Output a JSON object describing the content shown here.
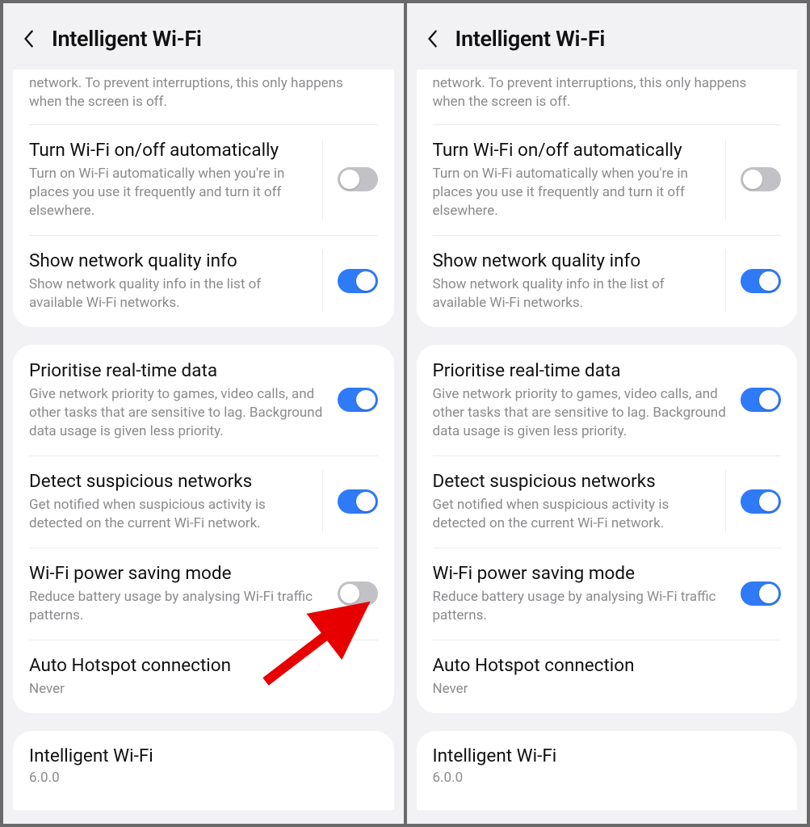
{
  "screens": [
    {
      "id": "left",
      "header": {
        "title": "Intelligent Wi‑Fi"
      },
      "top_cut_text": "network. To prevent interruptions, this only happens when the screen is off.",
      "group1": [
        {
          "key": "auto_wifi",
          "title": "Turn Wi‑Fi on/off automatically",
          "sub": "Turn on Wi‑Fi automatically when you're in places you use it frequently and turn it off elsewhere.",
          "on": false
        },
        {
          "key": "quality_info",
          "title": "Show network quality info",
          "sub": "Show network quality info in the list of available Wi‑Fi networks.",
          "on": true
        }
      ],
      "group2": [
        {
          "key": "prioritise",
          "title": "Prioritise real-time data",
          "sub": "Give network priority to games, video calls, and other tasks that are sensitive to lag. Background data usage is given less priority.",
          "on": true
        },
        {
          "key": "suspicious",
          "title": "Detect suspicious networks",
          "sub": "Get notified when suspicious activity is detected on the current Wi‑Fi network.",
          "on": true
        },
        {
          "key": "power_save",
          "title": "Wi‑Fi power saving mode",
          "sub": "Reduce battery usage by analysing Wi‑Fi traffic patterns.",
          "on": false
        },
        {
          "key": "auto_hotspot",
          "title": "Auto Hotspot connection",
          "sub": "Never",
          "no_toggle": true
        }
      ],
      "version": {
        "title": "Intelligent Wi‑Fi",
        "value": "6.0.0"
      },
      "arrow_target": "power_save"
    },
    {
      "id": "right",
      "header": {
        "title": "Intelligent Wi‑Fi"
      },
      "top_cut_text": "network. To prevent interruptions, this only happens when the screen is off.",
      "group1": [
        {
          "key": "auto_wifi",
          "title": "Turn Wi‑Fi on/off automatically",
          "sub": "Turn on Wi‑Fi automatically when you're in places you use it frequently and turn it off elsewhere.",
          "on": false
        },
        {
          "key": "quality_info",
          "title": "Show network quality info",
          "sub": "Show network quality info in the list of available Wi‑Fi networks.",
          "on": true
        }
      ],
      "group2": [
        {
          "key": "prioritise",
          "title": "Prioritise real-time data",
          "sub": "Give network priority to games, video calls, and other tasks that are sensitive to lag. Background data usage is given less priority.",
          "on": true
        },
        {
          "key": "suspicious",
          "title": "Detect suspicious networks",
          "sub": "Get notified when suspicious activity is detected on the current Wi‑Fi network.",
          "on": true
        },
        {
          "key": "power_save",
          "title": "Wi‑Fi power saving mode",
          "sub": "Reduce battery usage by analysing Wi‑Fi traffic patterns.",
          "on": true
        },
        {
          "key": "auto_hotspot",
          "title": "Auto Hotspot connection",
          "sub": "Never",
          "no_toggle": true
        }
      ],
      "version": {
        "title": "Intelligent Wi‑Fi",
        "value": "6.0.0"
      }
    }
  ]
}
